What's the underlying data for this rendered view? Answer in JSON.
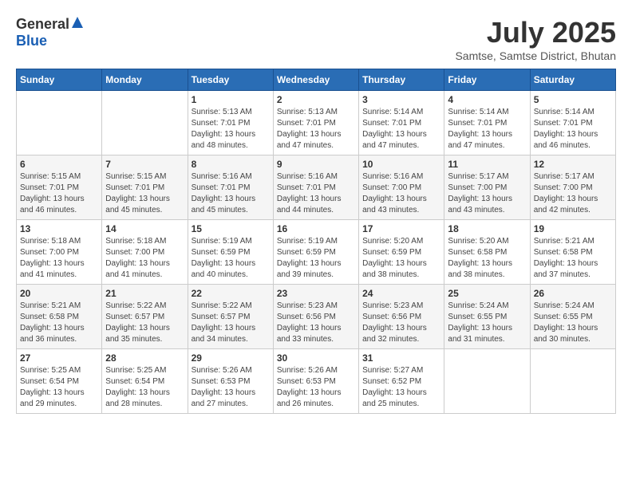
{
  "logo": {
    "general": "General",
    "blue": "Blue"
  },
  "title": {
    "month": "July 2025",
    "location": "Samtse, Samtse District, Bhutan"
  },
  "headers": [
    "Sunday",
    "Monday",
    "Tuesday",
    "Wednesday",
    "Thursday",
    "Friday",
    "Saturday"
  ],
  "weeks": [
    [
      {
        "day": "",
        "info": ""
      },
      {
        "day": "",
        "info": ""
      },
      {
        "day": "1",
        "sunrise": "Sunrise: 5:13 AM",
        "sunset": "Sunset: 7:01 PM",
        "daylight": "Daylight: 13 hours and 48 minutes."
      },
      {
        "day": "2",
        "sunrise": "Sunrise: 5:13 AM",
        "sunset": "Sunset: 7:01 PM",
        "daylight": "Daylight: 13 hours and 47 minutes."
      },
      {
        "day": "3",
        "sunrise": "Sunrise: 5:14 AM",
        "sunset": "Sunset: 7:01 PM",
        "daylight": "Daylight: 13 hours and 47 minutes."
      },
      {
        "day": "4",
        "sunrise": "Sunrise: 5:14 AM",
        "sunset": "Sunset: 7:01 PM",
        "daylight": "Daylight: 13 hours and 47 minutes."
      },
      {
        "day": "5",
        "sunrise": "Sunrise: 5:14 AM",
        "sunset": "Sunset: 7:01 PM",
        "daylight": "Daylight: 13 hours and 46 minutes."
      }
    ],
    [
      {
        "day": "6",
        "sunrise": "Sunrise: 5:15 AM",
        "sunset": "Sunset: 7:01 PM",
        "daylight": "Daylight: 13 hours and 46 minutes."
      },
      {
        "day": "7",
        "sunrise": "Sunrise: 5:15 AM",
        "sunset": "Sunset: 7:01 PM",
        "daylight": "Daylight: 13 hours and 45 minutes."
      },
      {
        "day": "8",
        "sunrise": "Sunrise: 5:16 AM",
        "sunset": "Sunset: 7:01 PM",
        "daylight": "Daylight: 13 hours and 45 minutes."
      },
      {
        "day": "9",
        "sunrise": "Sunrise: 5:16 AM",
        "sunset": "Sunset: 7:01 PM",
        "daylight": "Daylight: 13 hours and 44 minutes."
      },
      {
        "day": "10",
        "sunrise": "Sunrise: 5:16 AM",
        "sunset": "Sunset: 7:00 PM",
        "daylight": "Daylight: 13 hours and 43 minutes."
      },
      {
        "day": "11",
        "sunrise": "Sunrise: 5:17 AM",
        "sunset": "Sunset: 7:00 PM",
        "daylight": "Daylight: 13 hours and 43 minutes."
      },
      {
        "day": "12",
        "sunrise": "Sunrise: 5:17 AM",
        "sunset": "Sunset: 7:00 PM",
        "daylight": "Daylight: 13 hours and 42 minutes."
      }
    ],
    [
      {
        "day": "13",
        "sunrise": "Sunrise: 5:18 AM",
        "sunset": "Sunset: 7:00 PM",
        "daylight": "Daylight: 13 hours and 41 minutes."
      },
      {
        "day": "14",
        "sunrise": "Sunrise: 5:18 AM",
        "sunset": "Sunset: 7:00 PM",
        "daylight": "Daylight: 13 hours and 41 minutes."
      },
      {
        "day": "15",
        "sunrise": "Sunrise: 5:19 AM",
        "sunset": "Sunset: 6:59 PM",
        "daylight": "Daylight: 13 hours and 40 minutes."
      },
      {
        "day": "16",
        "sunrise": "Sunrise: 5:19 AM",
        "sunset": "Sunset: 6:59 PM",
        "daylight": "Daylight: 13 hours and 39 minutes."
      },
      {
        "day": "17",
        "sunrise": "Sunrise: 5:20 AM",
        "sunset": "Sunset: 6:59 PM",
        "daylight": "Daylight: 13 hours and 38 minutes."
      },
      {
        "day": "18",
        "sunrise": "Sunrise: 5:20 AM",
        "sunset": "Sunset: 6:58 PM",
        "daylight": "Daylight: 13 hours and 38 minutes."
      },
      {
        "day": "19",
        "sunrise": "Sunrise: 5:21 AM",
        "sunset": "Sunset: 6:58 PM",
        "daylight": "Daylight: 13 hours and 37 minutes."
      }
    ],
    [
      {
        "day": "20",
        "sunrise": "Sunrise: 5:21 AM",
        "sunset": "Sunset: 6:58 PM",
        "daylight": "Daylight: 13 hours and 36 minutes."
      },
      {
        "day": "21",
        "sunrise": "Sunrise: 5:22 AM",
        "sunset": "Sunset: 6:57 PM",
        "daylight": "Daylight: 13 hours and 35 minutes."
      },
      {
        "day": "22",
        "sunrise": "Sunrise: 5:22 AM",
        "sunset": "Sunset: 6:57 PM",
        "daylight": "Daylight: 13 hours and 34 minutes."
      },
      {
        "day": "23",
        "sunrise": "Sunrise: 5:23 AM",
        "sunset": "Sunset: 6:56 PM",
        "daylight": "Daylight: 13 hours and 33 minutes."
      },
      {
        "day": "24",
        "sunrise": "Sunrise: 5:23 AM",
        "sunset": "Sunset: 6:56 PM",
        "daylight": "Daylight: 13 hours and 32 minutes."
      },
      {
        "day": "25",
        "sunrise": "Sunrise: 5:24 AM",
        "sunset": "Sunset: 6:55 PM",
        "daylight": "Daylight: 13 hours and 31 minutes."
      },
      {
        "day": "26",
        "sunrise": "Sunrise: 5:24 AM",
        "sunset": "Sunset: 6:55 PM",
        "daylight": "Daylight: 13 hours and 30 minutes."
      }
    ],
    [
      {
        "day": "27",
        "sunrise": "Sunrise: 5:25 AM",
        "sunset": "Sunset: 6:54 PM",
        "daylight": "Daylight: 13 hours and 29 minutes."
      },
      {
        "day": "28",
        "sunrise": "Sunrise: 5:25 AM",
        "sunset": "Sunset: 6:54 PM",
        "daylight": "Daylight: 13 hours and 28 minutes."
      },
      {
        "day": "29",
        "sunrise": "Sunrise: 5:26 AM",
        "sunset": "Sunset: 6:53 PM",
        "daylight": "Daylight: 13 hours and 27 minutes."
      },
      {
        "day": "30",
        "sunrise": "Sunrise: 5:26 AM",
        "sunset": "Sunset: 6:53 PM",
        "daylight": "Daylight: 13 hours and 26 minutes."
      },
      {
        "day": "31",
        "sunrise": "Sunrise: 5:27 AM",
        "sunset": "Sunset: 6:52 PM",
        "daylight": "Daylight: 13 hours and 25 minutes."
      },
      {
        "day": "",
        "info": ""
      },
      {
        "day": "",
        "info": ""
      }
    ]
  ]
}
